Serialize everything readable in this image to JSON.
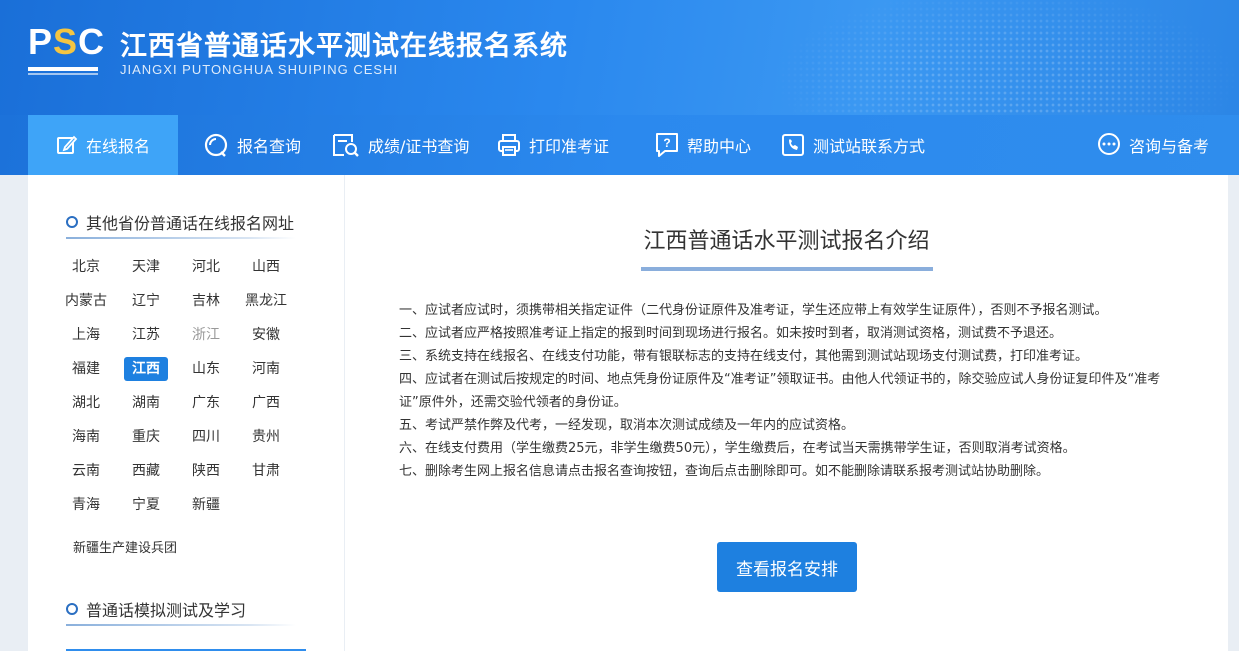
{
  "header": {
    "logo_text": "PSC",
    "title": "江西省普通话水平测试在线报名系统",
    "subtitle": "JIANGXI PUTONGHUA SHUIPING CESHI"
  },
  "nav": {
    "items": [
      {
        "label": "在线报名",
        "icon": "edit-icon"
      },
      {
        "label": "报名查询",
        "icon": "search-icon"
      },
      {
        "label": "成绩/证书查询",
        "icon": "certificate-search-icon"
      },
      {
        "label": "打印准考证",
        "icon": "printer-icon"
      },
      {
        "label": "帮助中心",
        "icon": "help-icon"
      },
      {
        "label": "测试站联系方式",
        "icon": "phone-icon"
      },
      {
        "label": "咨询与备考",
        "icon": "chat-icon"
      }
    ],
    "active_index": 0
  },
  "sidebar": {
    "provinces_heading": "其他省份普通话在线报名网址",
    "provinces": [
      "北京",
      "天津",
      "河北",
      "山西",
      "内蒙古",
      "辽宁",
      "吉林",
      "黑龙江",
      "上海",
      "江苏",
      "浙江",
      "安徽",
      "福建",
      "江西",
      "山东",
      "河南",
      "湖北",
      "湖南",
      "广东",
      "广西",
      "海南",
      "重庆",
      "四川",
      "贵州",
      "云南",
      "西藏",
      "陕西",
      "甘肃",
      "青海",
      "宁夏",
      "新疆"
    ],
    "wide_item": "新疆生产建设兵团",
    "active_province": "江西",
    "dim_province": "浙江",
    "study_heading": "普通话模拟测试及学习"
  },
  "main": {
    "title": "江西普通话水平测试报名介绍",
    "rules": [
      "一、应试者应试时，须携带相关指定证件（二代身份证原件及准考证，学生还应带上有效学生证原件），否则不予报名测试。",
      "二、应试者应严格按照准考证上指定的报到时间到现场进行报名。如未按时到者，取消测试资格，测试费不予退还。",
      "三、系统支持在线报名、在线支付功能，带有银联标志的支持在线支付，其他需到测试站现场支付测试费，打印准考证。",
      "四、应试者在测试后按规定的时间、地点凭身份证原件及“准考证”领取证书。由他人代领证书的，除交验应试人身份证复印件及“准考证”原件外，还需交验代领者的身份证。",
      "五、考试严禁作弊及代考，一经发现，取消本次测试成绩及一年内的应试资格。",
      "六、在线支付费用（学生缴费25元，非学生缴费50元），学生缴费后，在考试当天需携带学生证，否则取消考试资格。",
      "七、删除考生网上报名信息请点击报名查询按钮，查询后点击删除即可。如不能删除请联系报考测试站协助删除。"
    ],
    "cta_label": "查看报名安排"
  },
  "colors": {
    "header_blue": "#1a6fd8",
    "nav_active": "#3ea4f8",
    "accent": "#1e80e0",
    "logo_accent": "#f4c542"
  }
}
